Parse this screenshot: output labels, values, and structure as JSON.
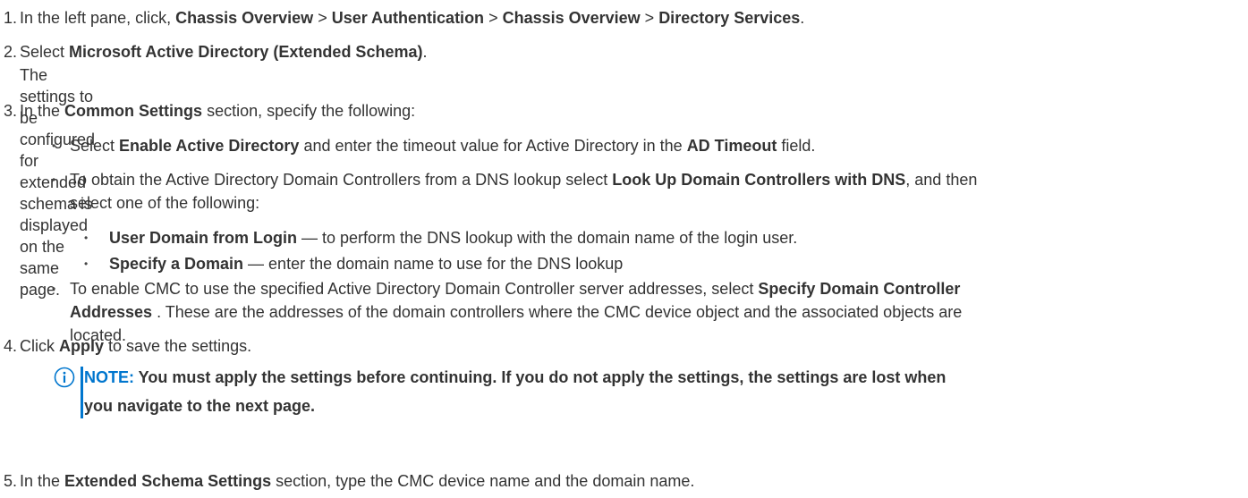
{
  "steps": [
    {
      "num": "1.",
      "html_parts": [
        "In the left pane, click, ",
        "Chassis Overview",
        " > ",
        "User Authentication",
        " > ",
        "Chassis Overview",
        " > ",
        "Directory Services",
        "."
      ]
    },
    {
      "num": "2.",
      "pre": "Select ",
      "bold": "Microsoft Active Directory (Extended Schema)",
      "post": ".",
      "sub": "The settings to be configured for extended schema is displayed on the same page."
    },
    {
      "num": "3.",
      "pre": "In the ",
      "bold": "Common Settings",
      "post": " section, specify the following:"
    },
    {
      "num": "4.",
      "pre": "Click ",
      "bold": "Apply",
      "post": " to save the settings."
    },
    {
      "num": "5.",
      "pre": "In the ",
      "bold": "Extended Schema Settings",
      "post": " section, type the CMC device name and the domain name."
    }
  ],
  "bullets": {
    "b1": {
      "pre": "Select ",
      "bold1": "Enable Active Directory",
      "mid": " and enter the timeout value for Active Directory in the ",
      "bold2": "AD Timeout",
      "post": " field."
    },
    "b2": {
      "pre": "To obtain the Active Directory Domain Controllers from a DNS lookup select ",
      "bold": "Look Up Domain Controllers with DNS",
      "post": ", and then",
      "line2": "select one of the following:"
    },
    "n1": {
      "bold": "User Domain from Login",
      "post": " — to perform the DNS lookup with the domain name of the login user."
    },
    "n2": {
      "bold": "Specify a Domain",
      "post": " — enter the domain name to use for the DNS lookup"
    },
    "b3": {
      "pre": "To enable CMC to use the specified Active Directory Domain Controller server addresses, select ",
      "bold1": "Specify Domain Controller",
      "bold2": "Addresses",
      "post": " . These are the addresses of the domain controllers where the CMC device object and the associated objects are",
      "line3": "located."
    }
  },
  "note": {
    "lead": "NOTE:",
    "text1": " You must apply the settings before continuing. If you do not apply the settings, the settings are lost when",
    "text2": "you navigate to the next page."
  },
  "colors": {
    "accent": "#0076ce",
    "text": "#333333"
  }
}
